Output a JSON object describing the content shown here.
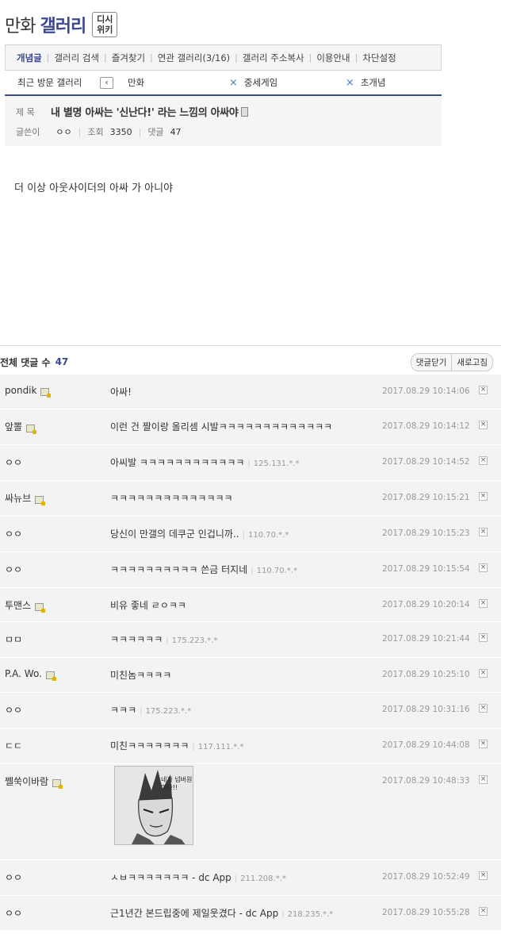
{
  "header": {
    "gallery_name": "만화",
    "gallery_word": "갤러리",
    "wiki_line1": "디시",
    "wiki_line2": "위키"
  },
  "tabs": [
    "개념글",
    "갤러리 검색",
    "즐겨찾기",
    "연관 갤러리(3/16)",
    "갤러리 주소복사",
    "이용안내",
    "차단설정"
  ],
  "recent": {
    "label": "최근 방문 갤러리",
    "prev": "‹",
    "items": [
      "만화",
      "중세게임",
      "초개념"
    ],
    "close_icon": "×"
  },
  "post": {
    "title_label": "제 목",
    "title": "내 별명 아싸는 '신난다!' 라는 느낌의 아싸야",
    "author_label": "글쓴이",
    "author": "ㅇㅇ",
    "views_label": "조회",
    "views": "3350",
    "comments_label": "댓글",
    "comments": "47",
    "body": "더 이상 아웃사이더의 아싸 가 아니야"
  },
  "comments_header": {
    "total_label": "전체 댓글 수",
    "total": "47",
    "collapse_button": "댓글닫기",
    "refresh_button": "새로고침"
  },
  "comments": [
    {
      "nick": "pondik",
      "lock": true,
      "text": "아싸!",
      "ip": "",
      "date": "2017.08.29 10:14:06"
    },
    {
      "nick": "앞뽈",
      "lock": true,
      "text": "이런 건 짤이랑 올리셈 시발ㅋㅋㅋㅋㅋㅋㅋㅋㅋㅋㅋㅋㅋ",
      "ip": "",
      "date": "2017.08.29 10:14:12"
    },
    {
      "nick": "ㅇㅇ",
      "lock": false,
      "text": "아씨발 ㅋㅋㅋㅋㅋㅋㅋㅋㅋㅋㅋㅋ",
      "ip": "125.131.*.*",
      "date": "2017.08.29 10:14:52"
    },
    {
      "nick": "싸뉴브",
      "lock": true,
      "text": "ㅋㅋㅋㅋㅋㅋㅋㅋㅋㅋㅋㅋㅋㅋ",
      "ip": "",
      "date": "2017.08.29 10:15:21"
    },
    {
      "nick": "ㅇㅇ",
      "lock": false,
      "text": "당신이 만갤의 데쿠군 인겁니까..",
      "ip": "110.70.*.*",
      "date": "2017.08.29 10:15:23"
    },
    {
      "nick": "ㅇㅇ",
      "lock": false,
      "text": "ㅋㅋㅋㅋㅋㅋㅋㅋㅋㅋ 쓴금 터지네",
      "ip": "110.70.*.*",
      "date": "2017.08.29 10:15:54"
    },
    {
      "nick": "투맨스",
      "lock": true,
      "text": "비유 좋네 ㄹㅇㅋㅋ",
      "ip": "",
      "date": "2017.08.29 10:20:14"
    },
    {
      "nick": "ㅁㅁ",
      "lock": false,
      "text": "ㅋㅋㅋㅋㅋㅋ",
      "ip": "175.223.*.*",
      "date": "2017.08.29 10:21:44"
    },
    {
      "nick": "P.A. Wo.",
      "lock": true,
      "text": "미친놈ㅋㅋㅋㅋ",
      "ip": "",
      "date": "2017.08.29 10:25:10"
    },
    {
      "nick": "ㅇㅇ",
      "lock": false,
      "text": "ㅋㅋㅋ",
      "ip": "175.223.*.*",
      "date": "2017.08.29 10:31:16"
    },
    {
      "nick": "ㄷㄷ",
      "lock": false,
      "text": "미친ㅋㅋㅋㅋㅋㅋㅋ",
      "ip": "117.111.*.*",
      "date": "2017.08.29 10:44:08"
    },
    {
      "nick": "쩰쑥이바람",
      "lock": true,
      "text": "",
      "ip": "",
      "date": "2017.08.29 10:48:33",
      "image_caption": "네가 넘버원이다!!"
    },
    {
      "nick": "ㅇㅇ",
      "lock": false,
      "text": "ㅅㅂㅋㅋㅋㅋㅋㅋㅋ - dc App",
      "ip": "211.208.*.*",
      "date": "2017.08.29 10:52:49"
    },
    {
      "nick": "ㅇㅇ",
      "lock": false,
      "text": "근1년간 본드립중에 제일웃겼다 - dc App",
      "ip": "218.235.*.*",
      "date": "2017.08.29 10:55:28"
    }
  ],
  "icons": {
    "delete": "×",
    "lock": "lock-icon",
    "image": "image-icon"
  },
  "colors": {
    "accent": "#3b4890",
    "row_bg": "#f3f3f3",
    "date": "#999999"
  }
}
